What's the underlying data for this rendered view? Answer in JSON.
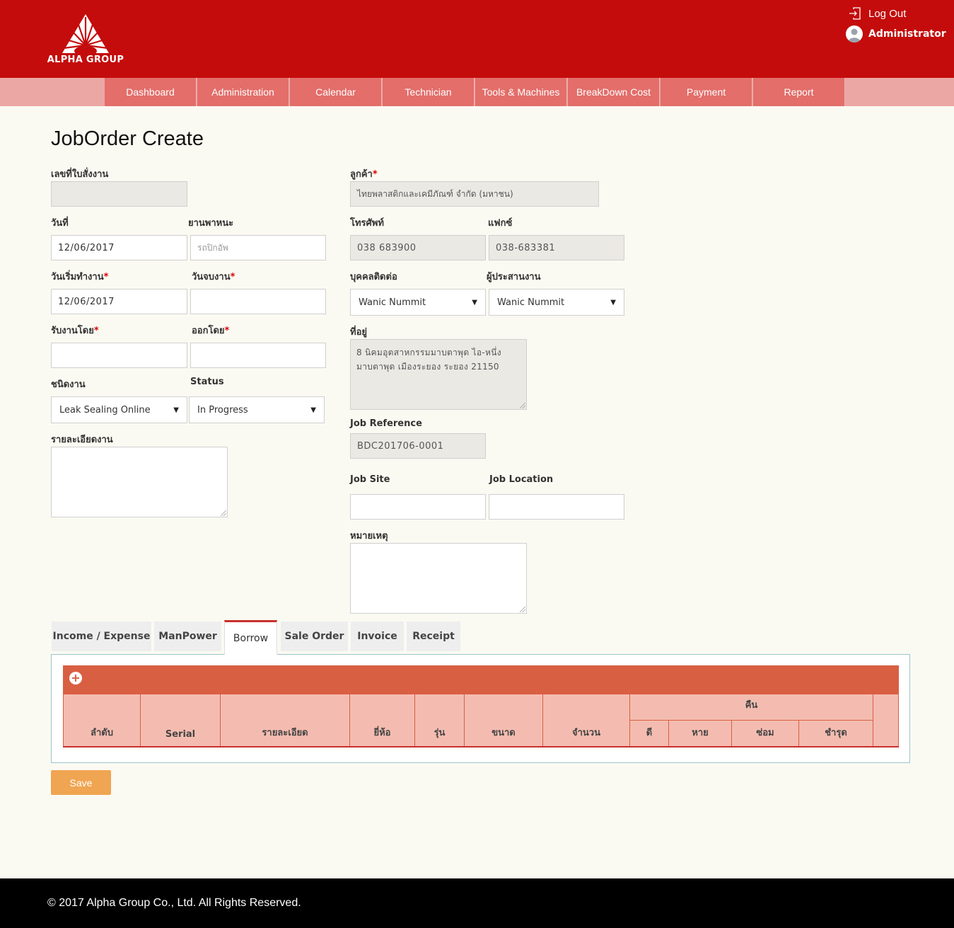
{
  "header": {
    "brand": "ALPHA GROUP",
    "logout_label": "Log Out",
    "user_name": "Administrator",
    "colors": {
      "header_bg": "#c40c0c",
      "nav_bg": "#eba7a4",
      "nav_item_bg": "#e36e6a"
    }
  },
  "nav": {
    "items": [
      {
        "label": "Dashboard"
      },
      {
        "label": "Administration"
      },
      {
        "label": "Calendar"
      },
      {
        "label": "Technician"
      },
      {
        "label": "Tools & Machines"
      },
      {
        "label": "BreakDown Cost"
      },
      {
        "label": "Payment"
      },
      {
        "label": "Report"
      }
    ]
  },
  "page": {
    "title": "JobOrder Create"
  },
  "form": {
    "order_no": {
      "label": "เลขที่ใบสั่งงาน",
      "value": ""
    },
    "date": {
      "label": "วันที่",
      "value": "12/06/2017"
    },
    "vehicle": {
      "label": "ยานพาหนะ",
      "placeholder": "รถปิกอัพ"
    },
    "start_date": {
      "label": "วันเริ่มทำงาน",
      "value": "12/06/2017"
    },
    "end_date": {
      "label": "วันจบงาน",
      "value": ""
    },
    "received_by": {
      "label": "รับงานโดย",
      "value": ""
    },
    "issued_by": {
      "label": "ออกโดย",
      "value": ""
    },
    "job_type": {
      "label": "ชนิดงาน",
      "value": "Leak Sealing Online"
    },
    "status": {
      "label": "Status",
      "value": "In Progress"
    },
    "job_detail": {
      "label": "รายละเอียดงาน",
      "value": ""
    },
    "customer": {
      "label": "ลูกค้า",
      "value": "ไทยพลาสติกและเคมีภัณฑ์ จำกัด (มหาชน)"
    },
    "phone": {
      "label": "โทรศัพท์",
      "value": "038 683900"
    },
    "fax": {
      "label": "แฟกซ์",
      "value": "038-683381"
    },
    "contact": {
      "label": "บุคคลติดต่อ",
      "value": "Wanic Nummit"
    },
    "coordinator": {
      "label": "ผู้ประสานงาน",
      "value": "Wanic Nummit"
    },
    "address": {
      "label": "ที่อยู่",
      "line1": "8 นิคมอุตสาหกรรมมาบตาพุด ไอ-หนึ่ง",
      "line2": "มาบตาพุด เมืองระยอง ระยอง  21150"
    },
    "job_reference": {
      "label": "Job Reference",
      "value": "BDC201706-0001"
    },
    "job_site": {
      "label": "Job Site",
      "value": ""
    },
    "job_location": {
      "label": "Job Location",
      "value": ""
    },
    "remark": {
      "label": "หมายเหตุ",
      "value": ""
    },
    "required_mark": "*"
  },
  "tabs": [
    {
      "label": "Income / Expense"
    },
    {
      "label": "ManPower"
    },
    {
      "label": "Borrow"
    },
    {
      "label": "Sale Order"
    },
    {
      "label": "Invoice"
    },
    {
      "label": "Receipt"
    }
  ],
  "borrow_table": {
    "add_symbol": "+",
    "columns": [
      "ลำดับ",
      "Serial",
      "รายละเอียด",
      "ยี่ห้อ",
      "รุ่น",
      "ขนาด",
      "จำนวน"
    ],
    "return_group": "คืน",
    "return_columns": [
      "ดี",
      "หาย",
      "ซ่อม",
      "ชำรุด"
    ]
  },
  "actions": {
    "save_label": "Save"
  },
  "footer": {
    "copyright": "© 2017 Alpha Group Co., Ltd. All Rights Reserved."
  }
}
